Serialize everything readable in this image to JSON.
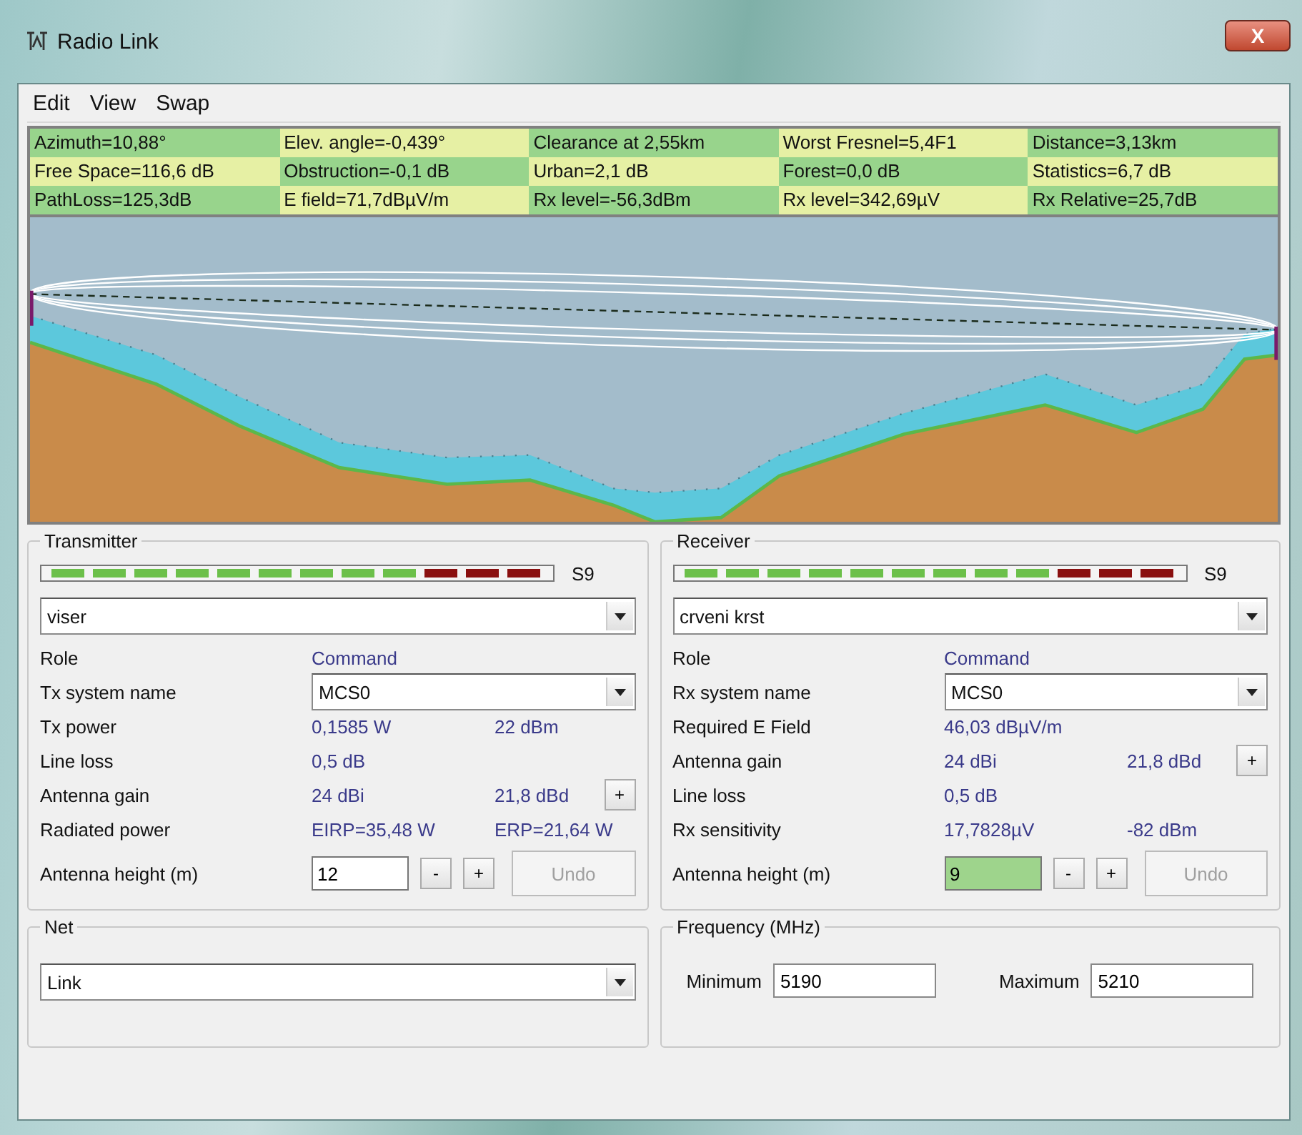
{
  "window": {
    "title": "Radio Link",
    "close": "X"
  },
  "menu": [
    "Edit",
    "View",
    "Swap"
  ],
  "info": [
    [
      "Azimuth=10,88°",
      "Elev. angle=-0,439°",
      "Clearance at 2,55km",
      "Worst Fresnel=5,4F1",
      "Distance=3,13km"
    ],
    [
      "Free Space=116,6 dB",
      "Obstruction=-0,1 dB",
      "Urban=2,1 dB",
      "Forest=0,0 dB",
      "Statistics=6,7 dB"
    ],
    [
      "PathLoss=125,3dB",
      "E field=71,7dBµV/m",
      "Rx level=-56,3dBm",
      "Rx level=342,69µV",
      "Rx Relative=25,7dB"
    ]
  ],
  "panels": [
    {
      "title": "Transmitter",
      "meter_label": "S9",
      "site": "viser",
      "rows": [
        {
          "kind": "text",
          "label": "Role",
          "value": "Command"
        },
        {
          "kind": "select",
          "label": "Tx system name",
          "value": "MCS0"
        },
        {
          "kind": "text",
          "label": "Tx power",
          "value": "0,1585 W",
          "value2": "22 dBm"
        },
        {
          "kind": "text",
          "label": "Line loss",
          "value": "0,5 dB"
        },
        {
          "kind": "text",
          "label": "Antenna gain",
          "value": "24 dBi",
          "value2": "21,8 dBd",
          "button": "+"
        },
        {
          "kind": "text",
          "label": "Radiated power",
          "value": "EIRP=35,48 W",
          "value2": "ERP=21,64 W"
        }
      ],
      "height": {
        "label": "Antenna height (m)",
        "value": "12",
        "highlighted": false,
        "minus": "-",
        "plus": "+",
        "undo": "Undo",
        "undo_disabled": true
      }
    },
    {
      "title": "Receiver",
      "meter_label": "S9",
      "site": "crveni krst",
      "rows": [
        {
          "kind": "text",
          "label": "Role",
          "value": "Command"
        },
        {
          "kind": "select",
          "label": "Rx system name",
          "value": "MCS0"
        },
        {
          "kind": "text",
          "label": "Required E Field",
          "value": "46,03 dBµV/m"
        },
        {
          "kind": "text",
          "label": "Antenna gain",
          "value": "24 dBi",
          "value2": "21,8 dBd",
          "button": "+"
        },
        {
          "kind": "text",
          "label": "Line loss",
          "value": "0,5 dB"
        },
        {
          "kind": "text",
          "label": "Rx sensitivity",
          "value": "17,7828µV",
          "value2": "-82 dBm"
        }
      ],
      "height": {
        "label": "Antenna height (m)",
        "value": "9",
        "highlighted": true,
        "minus": "-",
        "plus": "+",
        "undo": "Undo",
        "undo_disabled": true
      }
    }
  ],
  "net": {
    "title": "Net",
    "value": "Link"
  },
  "frequency": {
    "title": "Frequency (MHz)",
    "min_label": "Minimum",
    "min": "5190",
    "max_label": "Maximum",
    "max": "5210"
  }
}
